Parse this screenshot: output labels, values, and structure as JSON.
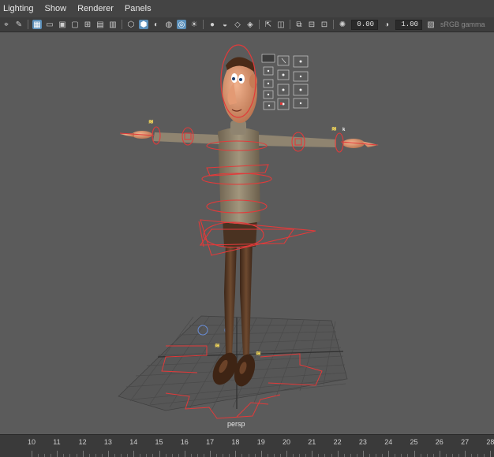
{
  "menu": [
    "Lighting",
    "Show",
    "Renderer",
    "Panels"
  ],
  "toolbar": {
    "exposure_value": "0.00",
    "gamma_value": "1.00",
    "color_space_label": "sRGB gamma"
  },
  "viewport": {
    "camera_label": "persp"
  },
  "timeline": {
    "ticks": [
      "10",
      "11",
      "12",
      "13",
      "14",
      "15",
      "16",
      "17",
      "18",
      "19",
      "20",
      "21",
      "22",
      "23",
      "24",
      "25",
      "26",
      "27",
      "28"
    ]
  }
}
